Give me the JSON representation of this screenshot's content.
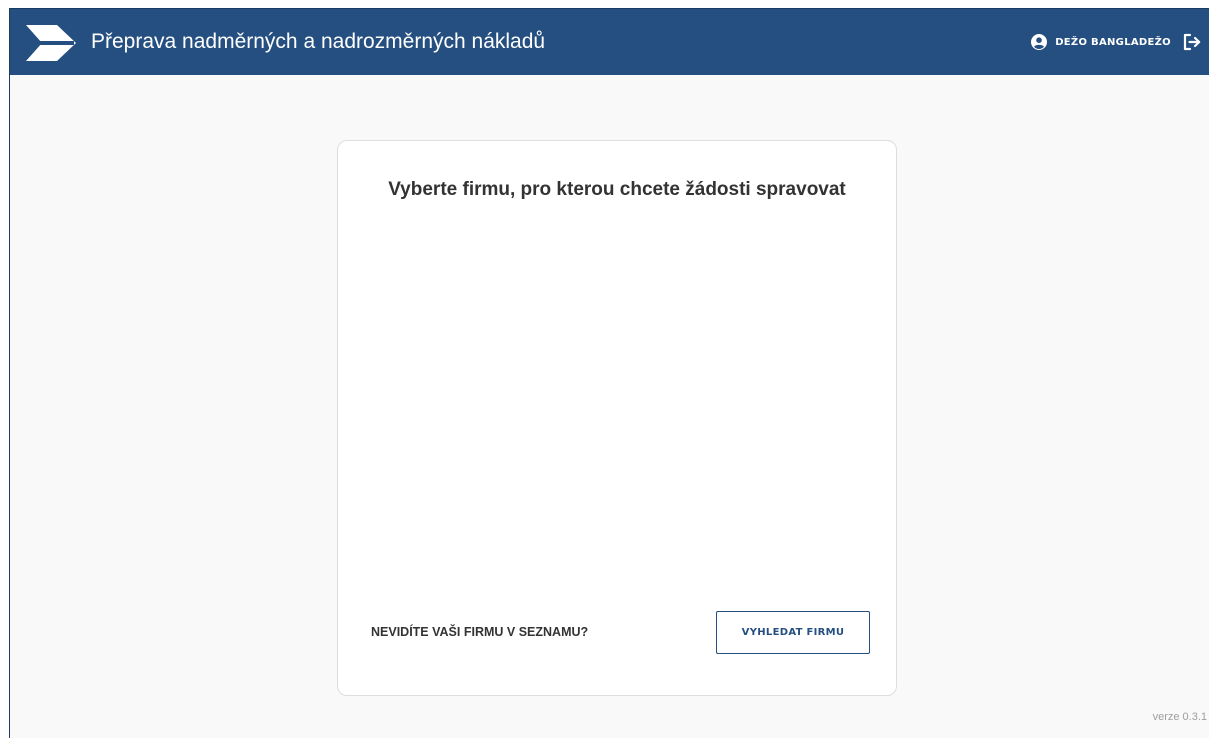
{
  "header": {
    "title": "Přeprava nadměrných a nadrozměrných nákladů",
    "user_name": "DEŽO BANGLADEŽO",
    "background_color": "#244f80"
  },
  "icons": {
    "logo": "arrow-logo-icon",
    "user": "user-circle-icon",
    "logout": "logout-icon"
  },
  "card": {
    "title": "Vyberte firmu, pro kterou chcete žádosti spravovat",
    "firms": [],
    "footer_text": "NEVIDÍTE VAŠI FIRMU V SEZNAMU?",
    "search_button_label": "VYHLEDAT FIRMU"
  },
  "footer": {
    "version": "verze 0.3.1"
  }
}
